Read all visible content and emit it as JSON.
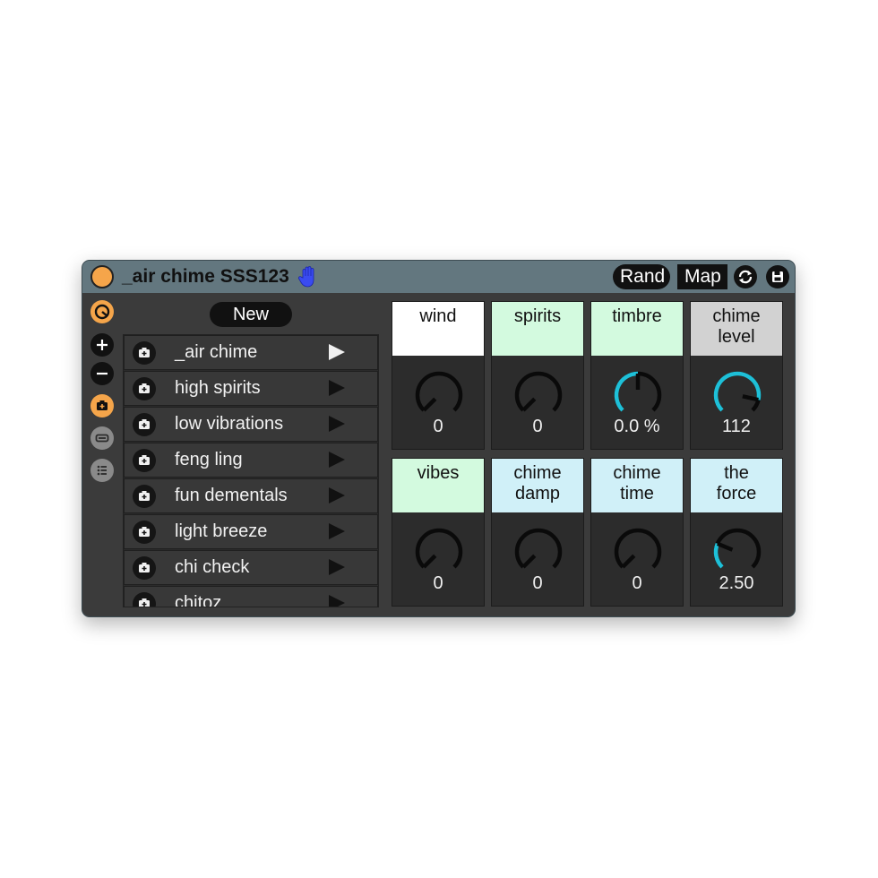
{
  "device": {
    "title": "_air chime SSS123",
    "rand_label": "Rand",
    "map_label": "Map"
  },
  "presets": {
    "new_label": "New",
    "items": [
      {
        "name": "_air chime",
        "active": true
      },
      {
        "name": "high spirits",
        "active": false
      },
      {
        "name": "low vibrations",
        "active": false
      },
      {
        "name": "feng ling",
        "active": false
      },
      {
        "name": "fun dementals",
        "active": false
      },
      {
        "name": "light breeze",
        "active": false
      },
      {
        "name": "chi check",
        "active": false
      },
      {
        "name": "chitoz",
        "active": false
      }
    ]
  },
  "params": [
    {
      "label": "wind",
      "value": "0",
      "header_color": "#ffffff",
      "position": 0.0,
      "arc_color": ""
    },
    {
      "label": "spirits",
      "value": "0",
      "header_color": "#d3fadf",
      "position": 0.0,
      "arc_color": ""
    },
    {
      "label": "timbre",
      "value": "0.0 %",
      "header_color": "#d3fadf",
      "position": 0.5,
      "arc_color": "#1ec0d8"
    },
    {
      "label": "chime\nlevel",
      "value": "112",
      "header_color": "#d2d2d2",
      "position": 0.88,
      "arc_color": "#1ec0d8"
    },
    {
      "label": "vibes",
      "value": "0",
      "header_color": "#d3fadf",
      "position": 0.0,
      "arc_color": ""
    },
    {
      "label": "chime\ndamp",
      "value": "0",
      "header_color": "#d0f0f8",
      "position": 0.0,
      "arc_color": ""
    },
    {
      "label": "chime\ntime",
      "value": "0",
      "header_color": "#d0f0f8",
      "position": 0.0,
      "arc_color": ""
    },
    {
      "label": "the\nforce",
      "value": "2.50",
      "header_color": "#d0f0f8",
      "position": 0.25,
      "arc_color": "#1ec0d8"
    }
  ],
  "icons": {
    "power": "power-icon",
    "hand": "hand-icon",
    "refresh": "refresh-icon",
    "save": "save-icon",
    "preset_row": "camera-icon",
    "play": "play-icon"
  },
  "colors": {
    "accent_orange": "#f5a54a",
    "hand_blue": "#3a4bf0",
    "knob_arc_active": "#1ec0d8"
  }
}
